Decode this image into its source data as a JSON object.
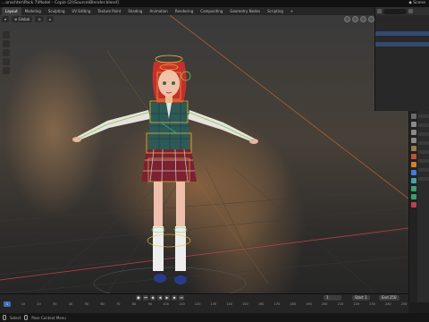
{
  "window": {
    "title": "...arachter\\Pack 7\\Model - Copie (2)\\Source\\Blender.blend]",
    "scene_label": "Scene"
  },
  "workspace_tabs": [
    "Layout",
    "Modeling",
    "Sculpting",
    "UV Editing",
    "Texture Paint",
    "Shading",
    "Animation",
    "Rendering",
    "Compositing",
    "Geometry Nodes",
    "Scripting",
    "+"
  ],
  "viewport": {
    "mode_label": "Global",
    "pose_options": "Pose Options"
  },
  "timeline": {
    "current_frame": "1",
    "start_label": "Start",
    "start_value": "1",
    "end_label": "End",
    "end_value": "250",
    "ruler": [
      "0",
      "10",
      "20",
      "30",
      "40",
      "50",
      "60",
      "70",
      "80",
      "90",
      "100",
      "110",
      "120",
      "130",
      "140",
      "150",
      "160",
      "170",
      "180",
      "190",
      "200",
      "210",
      "220",
      "230",
      "240",
      "250"
    ]
  },
  "statusbar": {
    "hint1": "Select",
    "hint2": "Pose Context Menu"
  },
  "colors": {
    "accent": "#4772b3",
    "x_axis": "#e0404a",
    "y_axis": "#6fb43f",
    "z_axis": "#4a78d6",
    "bone_yellow": "#e8c93c",
    "bone_green": "#7ec850"
  }
}
